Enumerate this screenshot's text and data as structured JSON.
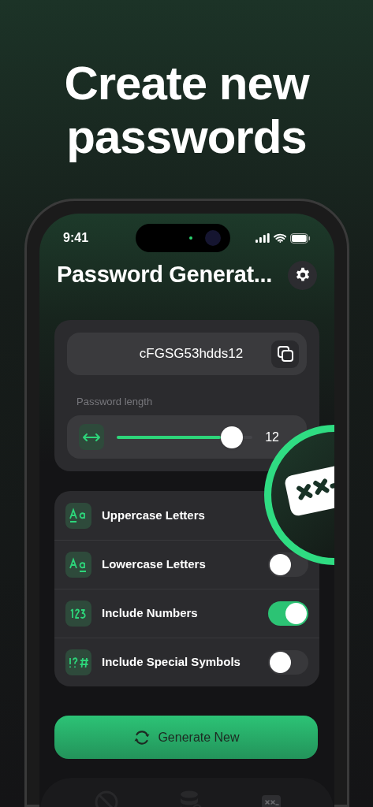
{
  "headline": "Create new passwords",
  "status_bar": {
    "time": "9:41"
  },
  "header": {
    "title": "Password Generat..."
  },
  "password": {
    "value": "cFGSG53hdds12"
  },
  "length": {
    "label": "Password length",
    "level": 0.87,
    "reading": "12"
  },
  "options": [
    {
      "kind": "upper",
      "label": "Uppercase Letters"
    },
    {
      "kind": "lower",
      "label": "Lowercase Letters",
      "on": false
    },
    {
      "kind": "numbers",
      "label": "Include Numbers",
      "on": true
    },
    {
      "kind": "symbols",
      "label": "Include Special Symbols",
      "on": false
    }
  ],
  "generate_button": {
    "label": "Generate New"
  },
  "tab_bar": [
    {
      "kind": "blocked",
      "selected": false
    },
    {
      "kind": "database",
      "selected": false
    },
    {
      "kind": "password",
      "selected": true
    }
  ]
}
